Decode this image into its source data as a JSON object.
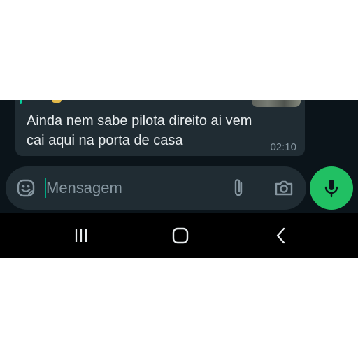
{
  "message": {
    "text_line1": "Ainda nem sabe pilota direito ai vem",
    "text_line2": "cai aqui na porta de casa",
    "time": "02:10"
  },
  "composer": {
    "placeholder": "Mensagem",
    "value": "",
    "icons": [
      "sticker-icon",
      "attach-icon",
      "camera-icon",
      "mic-icon"
    ]
  },
  "navbar": {
    "buttons": [
      "recent-apps",
      "home",
      "back"
    ]
  },
  "colors": {
    "chat_background": "#0b141a",
    "bubble": "#202c33",
    "accent": "#21c063",
    "text": "#e9edef",
    "muted": "#8696a0",
    "navbar": "#000000"
  }
}
